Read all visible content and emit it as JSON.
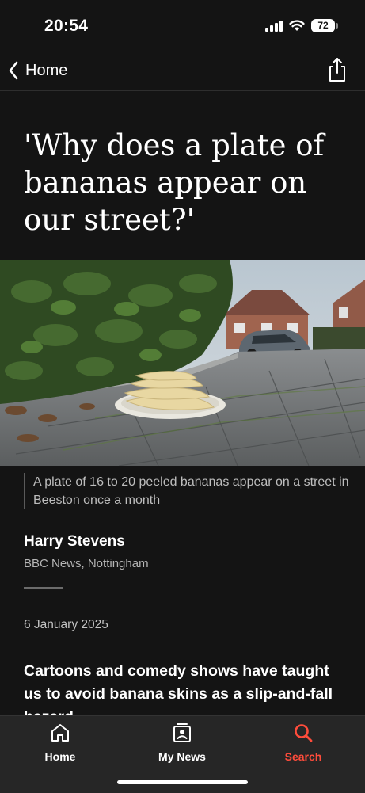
{
  "status_bar": {
    "time": "20:54",
    "battery_level": "72",
    "signal_icon": "cellular-signal-icon",
    "wifi_icon": "wifi-icon"
  },
  "nav": {
    "back_label": "Home",
    "back_icon": "chevron-left-icon",
    "share_icon": "share-icon"
  },
  "article": {
    "headline": "'Why does a plate of bananas appear on our street?'",
    "image_caption": "A plate of 16 to 20 peeled bananas appear on a street in Beeston once a month",
    "author": "Harry Stevens",
    "author_org": "BBC News, Nottingham",
    "date": "6 January 2025",
    "lead_paragraph": "Cartoons and comedy shows have taught us to avoid banana skins as a slip-and-fall hazard"
  },
  "tab_bar": {
    "tabs": [
      {
        "label": "Home",
        "icon": "home-icon",
        "active": false
      },
      {
        "label": "My News",
        "icon": "my-news-icon",
        "active": false
      },
      {
        "label": "Search",
        "icon": "search-icon",
        "active": true
      }
    ]
  },
  "colors": {
    "background": "#141414",
    "tab_bar": "#262626",
    "accent": "#ff4c3b",
    "text": "#ffffff",
    "muted_text": "#bdbdbd"
  }
}
